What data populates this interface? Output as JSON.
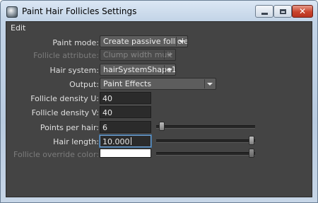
{
  "window": {
    "title": "Paint Hair Follicles Settings"
  },
  "menu": {
    "edit": "Edit"
  },
  "form": {
    "paint_mode": {
      "label": "Paint mode:",
      "value": "Create passive follicles"
    },
    "follicle_attribute": {
      "label": "Follicle attribute:",
      "value": "Clump width mult"
    },
    "hair_system": {
      "label": "Hair system:",
      "value": "hairSystemShape1"
    },
    "output": {
      "label": "Output:",
      "value": "Paint Effects"
    },
    "density_u": {
      "label": "Follicle density U:",
      "value": "40"
    },
    "density_v": {
      "label": "Follicle density V:",
      "value": "40"
    },
    "points_per_hair": {
      "label": "Points per hair:",
      "value": "6"
    },
    "hair_length": {
      "label": "Hair length:",
      "value": "10.000"
    },
    "override_color": {
      "label": "Follicle override color:",
      "color": "#ffffff"
    }
  }
}
